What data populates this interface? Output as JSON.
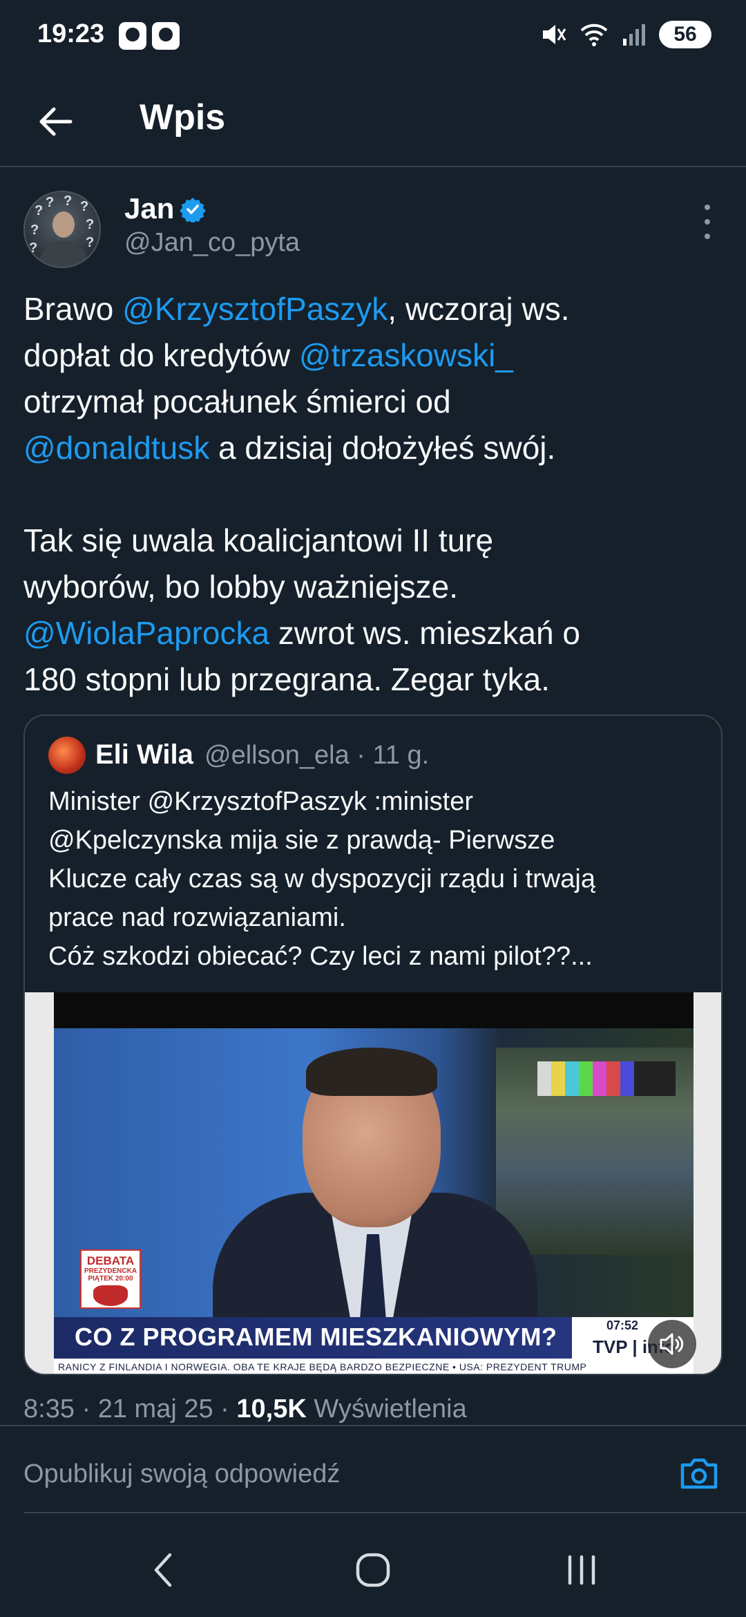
{
  "status_bar": {
    "time": "19:23",
    "battery": "56",
    "icons": [
      "mute-icon",
      "wifi-icon",
      "signal-icon",
      "battery-icon"
    ]
  },
  "header": {
    "title": "Wpis",
    "back_icon": "arrow-left-icon"
  },
  "tweet": {
    "author_name": "Jan",
    "author_handle": "@Jan_co_pyta",
    "verified": true,
    "text": {
      "l1_pre": "Brawo ",
      "l1_mention": "@KrzysztofPaszyk",
      "l1_post": ", wczoraj ws.",
      "l2_pre": "dopłat do kredytów ",
      "l2_mention": "@trzaskowski_",
      "l3": "otrzymał pocałunek śmierci od",
      "l4_mention": "@donaldtusk",
      "l4_post": " a dzisiaj dołożyłeś swój.",
      "l5": "Tak się uwala koalicjantowi II turę",
      "l6": "wyborów, bo lobby ważniejsze.",
      "l7_mention": "@WiolaPaprocka",
      "l7_post": " zwrot ws. mieszkań o",
      "l8": "180 stopni lub przegrana. Zegar tyka."
    },
    "timestamp": "8:35 · 21 maj 25 · ",
    "views_count": "10,5K",
    "views_label": " Wyświetlenia"
  },
  "quote": {
    "author_name": "Eli Wila",
    "meta": "@ellson_ela · 11 g.",
    "lines": [
      "Minister @KrzysztofPaszyk :minister",
      "@Kpelczynska mija sie z prawdą- Pierwsze",
      "Klucze cały czas są w dyspozycji rządu i trwają",
      "prace nad rozwiązaniami.",
      "Cóż szkodzi obiecać? Czy leci z nami pilot??..."
    ],
    "video": {
      "logo_line1": "DEBATA",
      "logo_line2": "PREZYDENCKA",
      "logo_line3": "PIĄTEK 20:00",
      "headline": "CO Z PROGRAMEM MIESZKANIOWYM?",
      "time": "07:52",
      "channel": "TVP | info",
      "ticker": "RANICY Z FINLANDIA I NORWEGIA. OBA TE KRAJE BĘDĄ BARDZO BEZPIECZNE • USA: PREZYDENT TRUMP"
    }
  },
  "reply": {
    "placeholder": "Opublikuj swoją odpowiedź",
    "camera_icon": "camera-icon"
  },
  "nav": {
    "icons": [
      "nav-back-icon",
      "nav-home-icon",
      "nav-recents-icon"
    ]
  }
}
